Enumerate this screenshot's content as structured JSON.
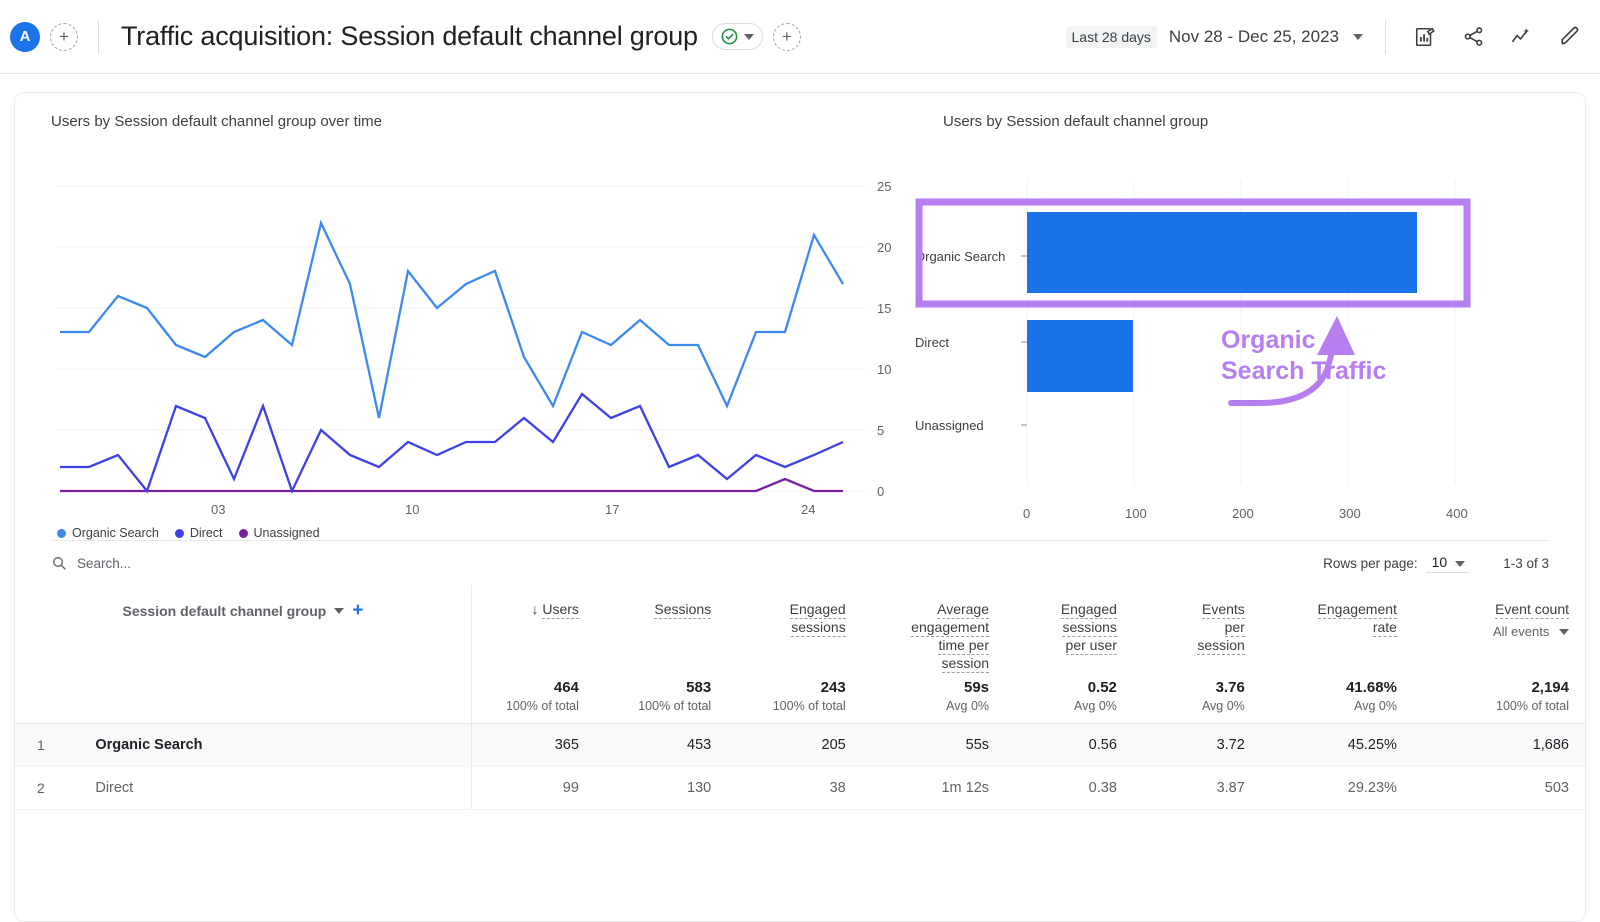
{
  "header": {
    "avatar_letter": "A",
    "add_label": "+",
    "title": "Traffic acquisition: Session default channel group",
    "check_icon": "check-circle-icon",
    "title_caret": "chevron-down-icon",
    "add_comparison": "+",
    "date_chip": "Last 28 days",
    "date_range": "Nov 28 - Dec 25, 2023",
    "icons": [
      "create-report-icon",
      "share-icon",
      "insights-icon",
      "edit-pencil-icon"
    ]
  },
  "line_chart": {
    "title": "Users by Session default channel group over time",
    "legend": [
      {
        "label": "Organic Search",
        "color": "#3c8af0"
      },
      {
        "label": "Direct",
        "color": "#4040e8"
      },
      {
        "label": "Unassigned",
        "color": "#7b1fa2"
      }
    ]
  },
  "bar_chart": {
    "title": "Users by Session default channel group"
  },
  "annotation": {
    "text": "Organic\nSearch Traffic",
    "color": "#b77ef0"
  },
  "table_controls": {
    "search_placeholder": "Search...",
    "search_icon": "search-icon",
    "rows_per_page_label": "Rows per page:",
    "rows_per_page_value": "10",
    "range_count": "1-3 of 3"
  },
  "table": {
    "dimension_header": "Session default channel group",
    "dimension_caret": "chevron-down-icon",
    "add_dimension": "+",
    "sort_arrow": "↓",
    "columns": [
      {
        "label": "Users",
        "sorted": true
      },
      {
        "label": "Sessions"
      },
      {
        "label": "Engaged\nsessions"
      },
      {
        "label": "Average\nengagement\ntime per\nsession"
      },
      {
        "label": "Engaged\nsessions\nper user"
      },
      {
        "label": "Events\nper\nsession"
      },
      {
        "label": "Engagement\nrate"
      },
      {
        "label": "Event count",
        "sub": "All events"
      }
    ],
    "totals": [
      {
        "value": "464",
        "sub": "100% of total"
      },
      {
        "value": "583",
        "sub": "100% of total"
      },
      {
        "value": "243",
        "sub": "100% of total"
      },
      {
        "value": "59s",
        "sub": "Avg 0%"
      },
      {
        "value": "0.52",
        "sub": "Avg 0%"
      },
      {
        "value": "3.76",
        "sub": "Avg 0%"
      },
      {
        "value": "41.68%",
        "sub": "Avg 0%"
      },
      {
        "value": "2,194",
        "sub": "100% of total"
      }
    ],
    "rows": [
      {
        "index": "1",
        "dimension": "Organic Search",
        "highlighted": true,
        "values": [
          "365",
          "453",
          "205",
          "55s",
          "0.56",
          "3.72",
          "45.25%",
          "1,686"
        ]
      },
      {
        "index": "2",
        "dimension": "Direct",
        "highlighted": false,
        "values": [
          "99",
          "130",
          "38",
          "1m 12s",
          "0.38",
          "3.87",
          "29.23%",
          "503"
        ]
      }
    ]
  },
  "chart_data": [
    {
      "type": "line",
      "title": "Users by Session default channel group over time",
      "xlabel": "",
      "ylabel": "",
      "ylim": [
        0,
        25
      ],
      "yticks": [
        0,
        5,
        10,
        15,
        20,
        25
      ],
      "xticks": [
        "03\nDec",
        "10",
        "17",
        "24"
      ],
      "grid": true,
      "legend_position": "bottom",
      "x": [
        "Nov 28",
        "Nov 29",
        "Nov 30",
        "Dec 01",
        "Dec 02",
        "Dec 03",
        "Dec 04",
        "Dec 05",
        "Dec 06",
        "Dec 07",
        "Dec 08",
        "Dec 09",
        "Dec 10",
        "Dec 11",
        "Dec 12",
        "Dec 13",
        "Dec 14",
        "Dec 15",
        "Dec 16",
        "Dec 17",
        "Dec 18",
        "Dec 19",
        "Dec 20",
        "Dec 21",
        "Dec 22",
        "Dec 23",
        "Dec 24",
        "Dec 25"
      ],
      "series": [
        {
          "name": "Organic Search",
          "color": "#3c8af0",
          "values": [
            13,
            13,
            16,
            15,
            12,
            11,
            13,
            14,
            12,
            22,
            17,
            6,
            18,
            15,
            17,
            18,
            11,
            7,
            13,
            12,
            14,
            12,
            12,
            7,
            13,
            13,
            21,
            17
          ]
        },
        {
          "name": "Direct",
          "color": "#4040e8",
          "values": [
            2,
            2,
            3,
            0,
            7,
            6,
            1,
            7,
            0,
            5,
            3,
            2,
            4,
            3,
            4,
            4,
            6,
            4,
            8,
            6,
            7,
            2,
            3,
            1,
            3,
            2,
            3,
            4
          ]
        },
        {
          "name": "Unassigned",
          "color": "#7b1fa2",
          "values": [
            0,
            0,
            0,
            0,
            0,
            0,
            0,
            0,
            0,
            0,
            0,
            0,
            0,
            0,
            0,
            0,
            0,
            0,
            0,
            0,
            0,
            0,
            0,
            0,
            0,
            1,
            0,
            0
          ]
        }
      ]
    },
    {
      "type": "bar",
      "orientation": "horizontal",
      "title": "Users by Session default channel group",
      "categories": [
        "Organic Search",
        "Direct",
        "Unassigned"
      ],
      "values": [
        365,
        99,
        0
      ],
      "color": "#1a73e8",
      "xlim": [
        0,
        400
      ],
      "xticks": [
        0,
        100,
        200,
        300,
        400
      ],
      "grid": true,
      "annotation": {
        "text": "Organic Search Traffic",
        "target": "Organic Search",
        "color": "#b77ef0"
      }
    }
  ]
}
